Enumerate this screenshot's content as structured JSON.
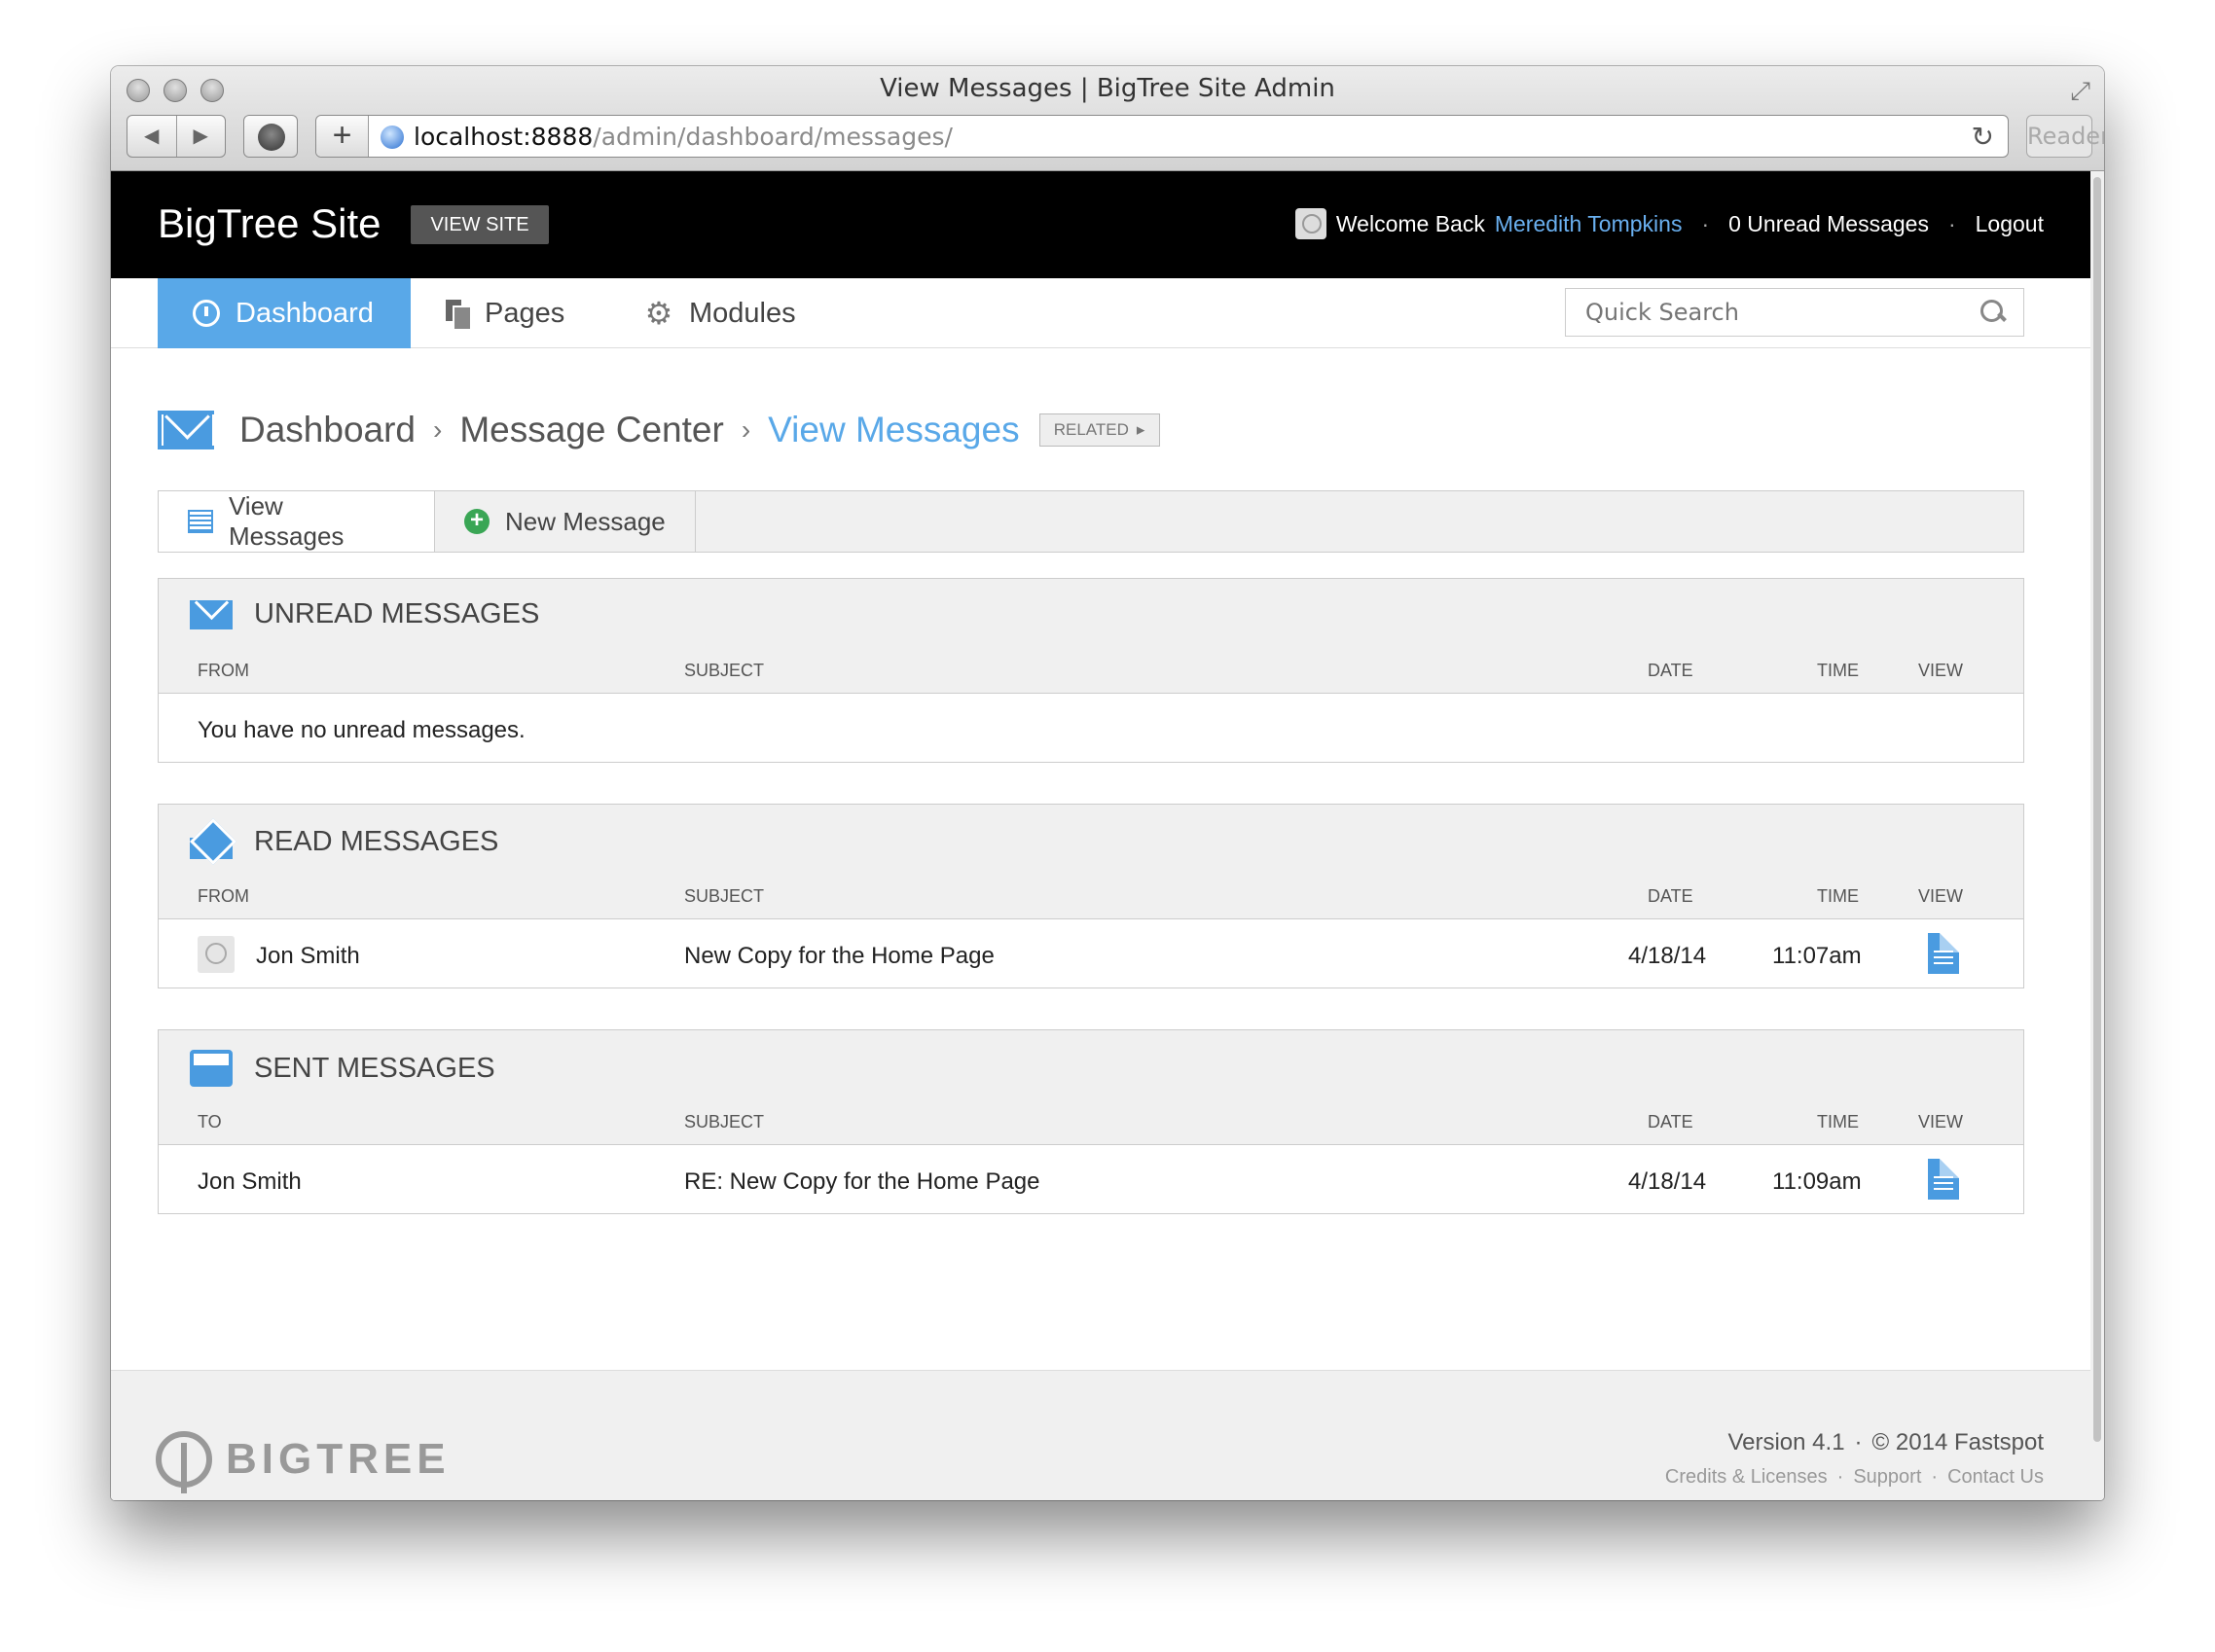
{
  "browser": {
    "window_title": "View Messages | BigTree Site Admin",
    "url_host": "localhost:8888",
    "url_path": "/admin/dashboard/messages/",
    "reader_label": "Reader"
  },
  "header": {
    "site_name": "BigTree Site",
    "view_site_label": "VIEW SITE",
    "welcome_text": "Welcome Back",
    "user_name": "Meredith Tompkins",
    "unread_label": "0 Unread Messages",
    "logout_label": "Logout"
  },
  "nav": {
    "items": [
      {
        "label": "Dashboard",
        "icon": "dashboard-icon",
        "active": true
      },
      {
        "label": "Pages",
        "icon": "pages-icon"
      },
      {
        "label": "Modules",
        "icon": "gear-icon"
      }
    ],
    "search_placeholder": "Quick Search"
  },
  "breadcrumb": {
    "items": [
      "Dashboard",
      "Message Center",
      "View Messages"
    ],
    "related_label": "RELATED"
  },
  "subnav": {
    "tabs": [
      {
        "label": "View Messages",
        "icon": "list-icon",
        "active": true
      },
      {
        "label": "New Message",
        "icon": "add-icon"
      }
    ]
  },
  "unread": {
    "title": "UNREAD MESSAGES",
    "columns": {
      "from": "FROM",
      "subject": "SUBJECT",
      "date": "DATE",
      "time": "TIME",
      "view": "VIEW"
    },
    "empty_text": "You have no unread messages."
  },
  "read": {
    "title": "READ MESSAGES",
    "columns": {
      "from": "FROM",
      "subject": "SUBJECT",
      "date": "DATE",
      "time": "TIME",
      "view": "VIEW"
    },
    "rows": [
      {
        "from": "Jon Smith",
        "subject": "New Copy for the Home Page",
        "date": "4/18/14",
        "time": "11:07am"
      }
    ]
  },
  "sent": {
    "title": "SENT MESSAGES",
    "columns": {
      "to": "TO",
      "subject": "SUBJECT",
      "date": "DATE",
      "time": "TIME",
      "view": "VIEW"
    },
    "rows": [
      {
        "to": "Jon Smith",
        "subject": "RE: New Copy for the Home Page",
        "date": "4/18/14",
        "time": "11:09am"
      }
    ]
  },
  "footer": {
    "brand": "BIGTREE",
    "version": "Version 4.1",
    "copyright": "© 2014 Fastspot",
    "links": [
      "Credits & Licenses",
      "Support",
      "Contact Us"
    ]
  },
  "colors": {
    "accent": "#59a8e8",
    "header_bg": "#000000",
    "add_green": "#3aa655"
  }
}
